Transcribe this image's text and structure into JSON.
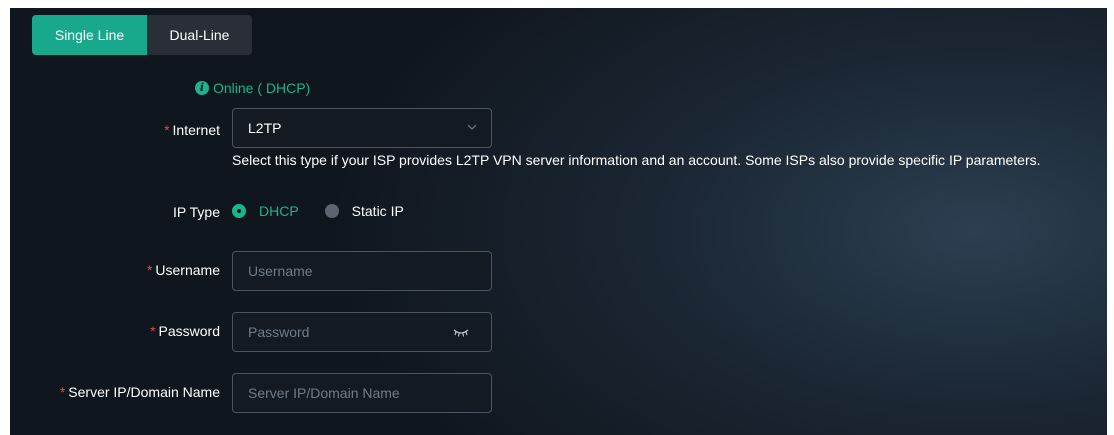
{
  "tabs": {
    "single_line": "Single Line",
    "dual_line": "Dual-Line"
  },
  "status": {
    "text": "Online ( DHCP)",
    "icon": "info-icon",
    "color": "#18b48e"
  },
  "internet": {
    "label": "Internet",
    "value": "L2TP",
    "hint": "Select this type if your ISP provides L2TP VPN server information and an account. Some ISPs also provide specific IP parameters."
  },
  "ip_type": {
    "label": "IP Type",
    "options": [
      "DHCP",
      "Static IP"
    ],
    "selected": "DHCP"
  },
  "username": {
    "label": "Username",
    "placeholder": "Username",
    "value": ""
  },
  "password": {
    "label": "Password",
    "placeholder": "Password",
    "value": ""
  },
  "server": {
    "label": "Server IP/Domain Name",
    "placeholder": "Server IP/Domain Name",
    "value": ""
  },
  "colors": {
    "accent": "#18a88c",
    "required": "#e5484d",
    "background": "#10161e"
  }
}
